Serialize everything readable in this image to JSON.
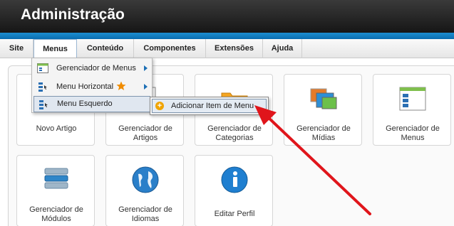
{
  "app": {
    "title": "Administração"
  },
  "menubar": {
    "items": [
      {
        "label": "Site"
      },
      {
        "label": "Menus"
      },
      {
        "label": "Conteúdo"
      },
      {
        "label": "Componentes"
      },
      {
        "label": "Extensões"
      },
      {
        "label": "Ajuda"
      }
    ]
  },
  "dropdown": {
    "items": [
      {
        "label": "Gerenciador de Menus",
        "icon": "menu-manager-icon"
      },
      {
        "label": "Menu Horizontal",
        "icon": "horizontal-menu-icon",
        "badge_icon": "star-icon"
      },
      {
        "label": "Menu Esquerdo",
        "icon": "left-menu-icon"
      }
    ],
    "submenu": {
      "label": "Adicionar Item de Menu",
      "icon": "add-icon"
    }
  },
  "tiles": [
    {
      "label": "Novo Artigo",
      "icon": "new-article-icon"
    },
    {
      "label": "Gerenciador de Artigos",
      "icon": "article-manager-icon"
    },
    {
      "label": "Gerenciador de Categorias",
      "icon": "category-manager-icon"
    },
    {
      "label": "Gerenciador de Mídias",
      "icon": "media-manager-icon"
    },
    {
      "label": "Gerenciador de Menus",
      "icon": "menu-manager-icon"
    },
    {
      "label": "Gerenciador de Módulos",
      "icon": "module-manager-icon"
    },
    {
      "label": "Gerenciador de Idiomas",
      "icon": "language-manager-icon"
    },
    {
      "label": "Editar Perfil",
      "icon": "edit-profile-icon"
    }
  ],
  "annotation": {
    "arrow_color": "#e0151b"
  },
  "colors": {
    "header": "#161616",
    "accent_blue": "#0a6db0",
    "star": "#f08c00"
  }
}
